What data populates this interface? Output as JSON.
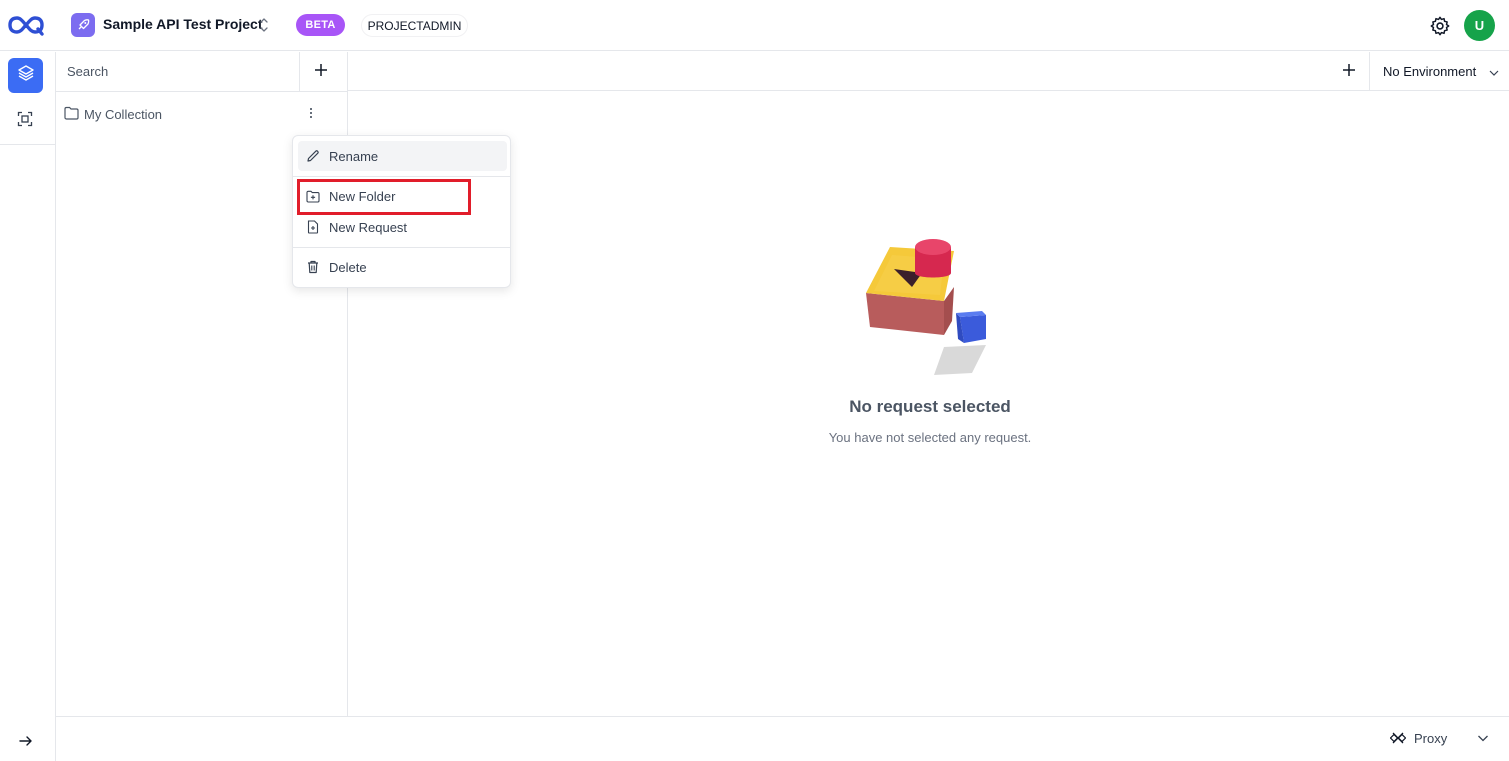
{
  "header": {
    "project_name": "Sample API Test Project",
    "beta_badge": "BETA",
    "role_badge": "PROJECTADMIN",
    "avatar_initial": "U"
  },
  "colors": {
    "accent": "#3b6cf4",
    "beta": "#a855f7",
    "avatar": "#16a34a",
    "project_icon": "#7c6cf0",
    "highlight": "#e11d2a"
  },
  "icons": {
    "logo": "logo-icon",
    "project": "rocket-icon",
    "switch": "chevron-up-down-icon",
    "settings": "gear-icon",
    "collections": "layers-icon",
    "environments": "frame-icon",
    "expand": "arrow-right-icon",
    "add": "plus-icon",
    "folder": "folder-icon",
    "more": "more-vertical-icon",
    "rename": "pencil-icon",
    "new_folder": "folder-plus-icon",
    "new_request": "file-plus-icon",
    "delete": "trash-icon",
    "proxy": "proxy-icon"
  },
  "sidebar": {
    "search_placeholder": "Search",
    "collections": [
      {
        "label": "My Collection"
      }
    ]
  },
  "context_menu": {
    "items": [
      {
        "label": "Rename"
      },
      {
        "label": "New Folder"
      },
      {
        "label": "New Request"
      },
      {
        "label": "Delete"
      }
    ]
  },
  "main": {
    "environment": "No Environment",
    "empty_title": "No request selected",
    "empty_subtitle": "You have not selected any request."
  },
  "footer": {
    "proxy_label": "Proxy"
  }
}
